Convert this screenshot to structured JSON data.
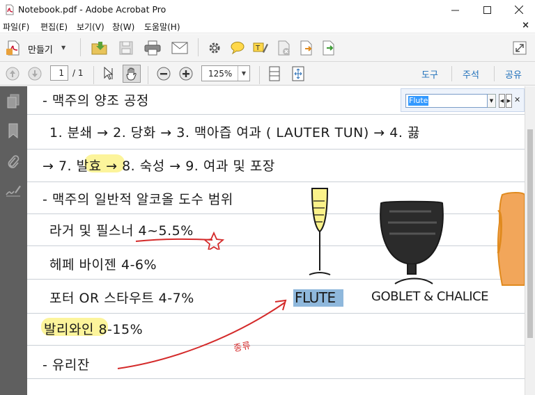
{
  "window": {
    "title": "Notebook.pdf - Adobe Acrobat Pro"
  },
  "menu": {
    "items": [
      "파일(F)",
      "편집(E)",
      "보기(V)",
      "창(W)",
      "도움말(H)"
    ],
    "close_doc": "×"
  },
  "toolbar": {
    "create_label": "만들기"
  },
  "pagenav": {
    "current_page": "1",
    "total": "/ 1"
  },
  "zoom": {
    "value": "125%"
  },
  "right_panes": [
    "도구",
    "주석",
    "공유"
  ],
  "find": {
    "query": "Flute"
  },
  "document": {
    "lines": [
      "- 맥주의 양조 공정",
      "1. 분쇄 → 2. 당화 → 3. 맥아즙 여과 ( LAUTER TUN) → 4. 끓",
      "→ 7. 발효 → 8. 숙성 → 9. 여과 및 포장",
      "- 맥주의 일반적 알코올 도수 범위",
      "라거 및 필스너  4~5.5%",
      "헤페 바이젠  4-6%",
      "포터 OR 스타우트  4-7%",
      "발리와인  8-15%",
      "- 유리잔"
    ],
    "glass_labels": [
      "FLUTE",
      "GOBLET & CHALICE"
    ],
    "annotation": "종류",
    "highlight_color": "#fbf28a",
    "search_highlight_color": "#8fb8dc",
    "pen_red": "#d42a2a"
  }
}
